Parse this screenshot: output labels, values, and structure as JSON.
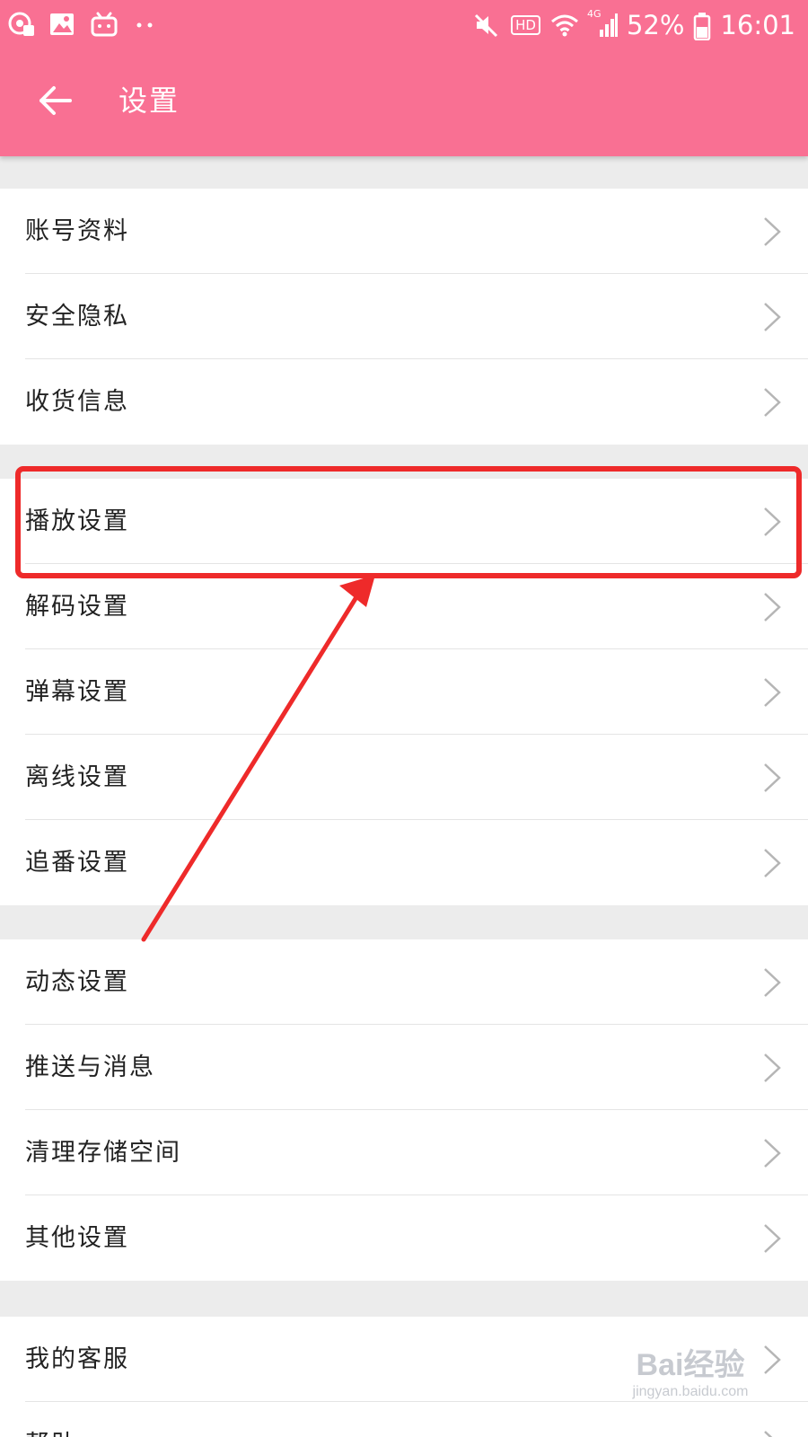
{
  "status_bar": {
    "battery_percent": "52%",
    "time": "16:01",
    "hd_label": "HD",
    "network_label": "4G",
    "left_icons": [
      "location-icon",
      "gallery-icon",
      "bilibili-icon",
      "more-dots-icon"
    ],
    "right_icons": [
      "mute-icon",
      "hd-icon",
      "wifi-icon",
      "signal-icon",
      "battery-icon"
    ]
  },
  "toolbar": {
    "title": "设置",
    "back_icon": "arrow-left-icon"
  },
  "colors": {
    "appbar": "#f97093",
    "background": "#ececec",
    "highlight_annotation": "#ee2a2a"
  },
  "groups": [
    {
      "items": [
        {
          "label": "账号资料"
        },
        {
          "label": "安全隐私"
        },
        {
          "label": "收货信息"
        }
      ]
    },
    {
      "items": [
        {
          "label": "播放设置",
          "highlighted": true
        },
        {
          "label": "解码设置"
        },
        {
          "label": "弹幕设置"
        },
        {
          "label": "离线设置"
        },
        {
          "label": "追番设置"
        }
      ]
    },
    {
      "items": [
        {
          "label": "动态设置"
        },
        {
          "label": "推送与消息"
        },
        {
          "label": "清理存储空间"
        },
        {
          "label": "其他设置"
        }
      ]
    },
    {
      "items": [
        {
          "label": "我的客服"
        },
        {
          "label": "帮助"
        }
      ]
    }
  ],
  "watermark": {
    "brand": "Bai经验",
    "url": "jingyan.baidu.com"
  }
}
